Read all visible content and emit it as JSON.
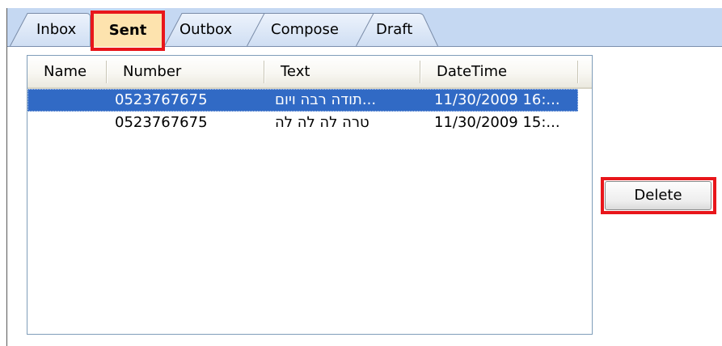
{
  "tabs": [
    {
      "label": "Inbox",
      "active": false
    },
    {
      "label": "Sent",
      "active": true
    },
    {
      "label": "Outbox",
      "active": false
    },
    {
      "label": "Compose",
      "active": false
    },
    {
      "label": "Draft",
      "active": false
    }
  ],
  "messages_list": {
    "columns": [
      "Name",
      "Number",
      "Text",
      "DateTime"
    ],
    "rows": [
      {
        "name": "",
        "number": "0523767675",
        "text": "תודה רבה ויום...",
        "datetime": "11/30/2009 16:...",
        "selected": true
      },
      {
        "name": "",
        "number": "0523767675",
        "text": "טרה לה לה לה",
        "datetime": "11/30/2009 15:...",
        "selected": false
      }
    ]
  },
  "actions": {
    "delete_label": "Delete"
  },
  "colors": {
    "tab_strip": "#c5d8f2",
    "active_tab": "#fde3ae",
    "selection": "#316ac5",
    "highlight_box": "#e8161b",
    "list_border": "#7f9db9"
  }
}
